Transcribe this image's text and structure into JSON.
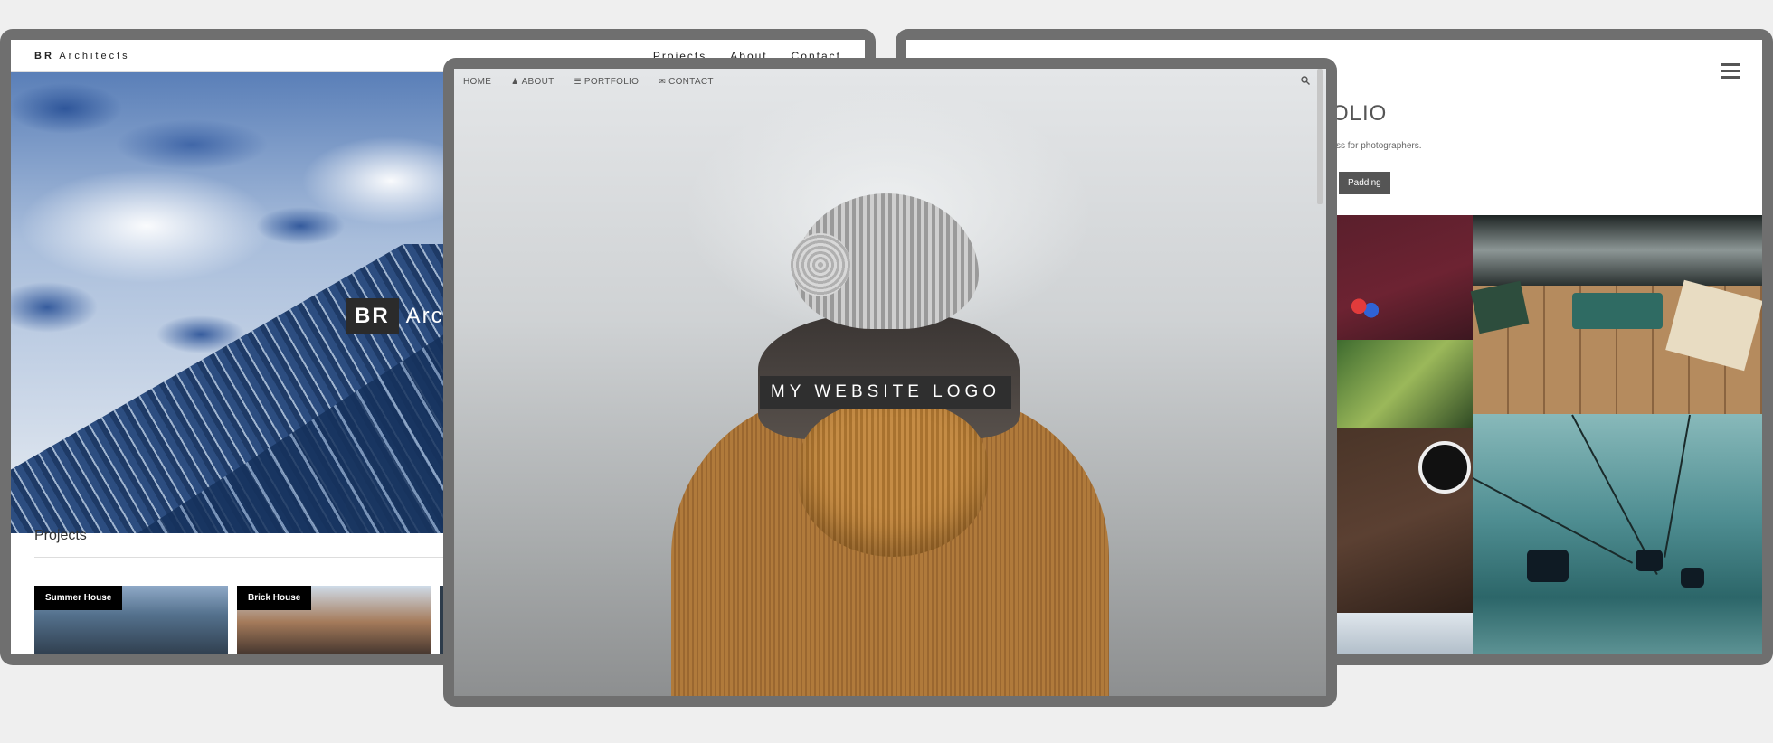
{
  "left_site": {
    "brand_bold": "BR",
    "brand_rest": "Architects",
    "nav": [
      "Projects",
      "About",
      "Contact"
    ],
    "hero_logo_bold": "BR",
    "hero_logo_rest": "Arc",
    "section_title": "Projects",
    "projects": [
      "Summer House",
      "Brick House"
    ]
  },
  "center_site": {
    "nav": [
      {
        "label": "HOME",
        "icon": ""
      },
      {
        "label": "ABOUT",
        "icon": "user-icon"
      },
      {
        "label": "PORTFOLIO",
        "icon": "list-icon"
      },
      {
        "label": "CONTACT",
        "icon": "envelope-icon"
      }
    ],
    "search_icon": "search-icon",
    "logo_text": "MY WEBSITE LOGO"
  },
  "right_site": {
    "title_fragment": "OLIO",
    "subtitle_fragment": "css for photographers.",
    "button_label": "Padding",
    "menu_icon": "hamburger-icon"
  },
  "colors": {
    "frame": "#6f6f6f",
    "background": "#efefef",
    "logo_banner": "#2f2f2f"
  }
}
